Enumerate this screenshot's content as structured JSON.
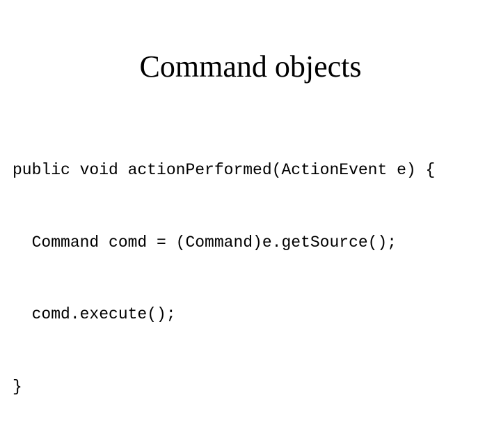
{
  "slide": {
    "title": "Command objects",
    "code_lines": [
      "public void actionPerformed(ActionEvent e) {",
      "  Command comd = (Command)e.getSource();",
      "  comd.execute();",
      "}"
    ]
  }
}
